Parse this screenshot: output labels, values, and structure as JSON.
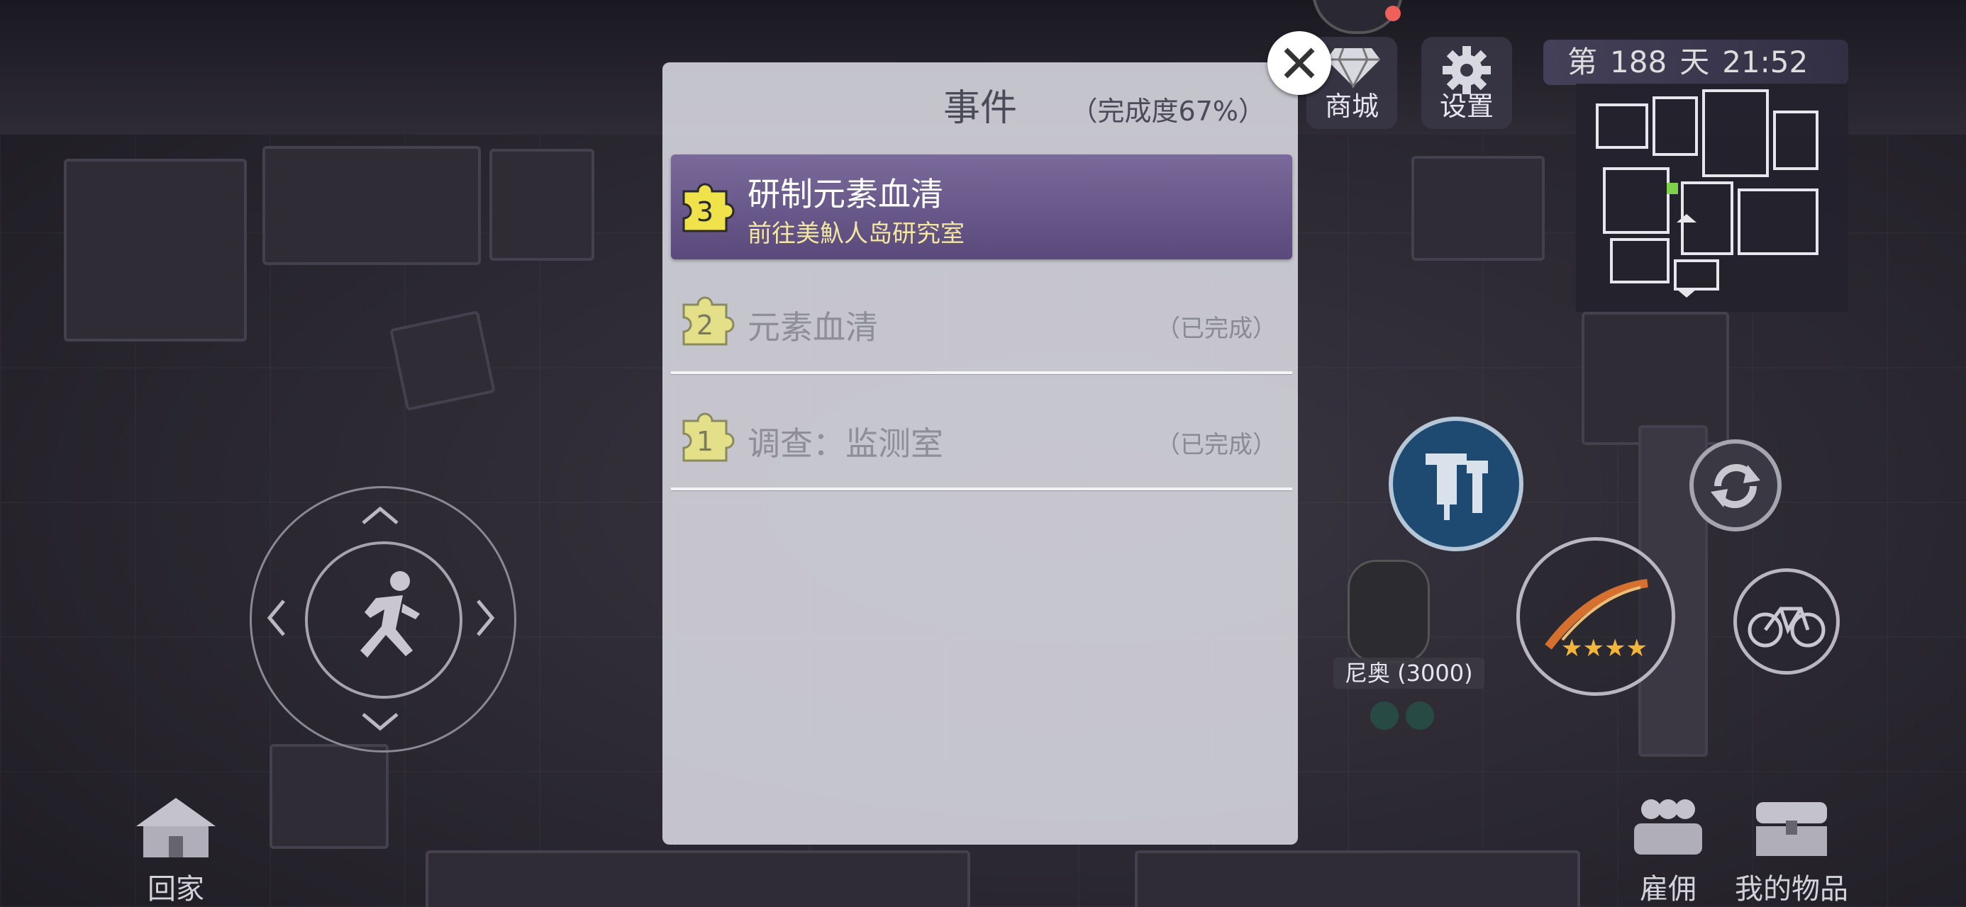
{
  "hud": {
    "shop_label": "商城",
    "settings_label": "设置",
    "day_prefix": "第",
    "day_number": "188",
    "day_suffix": "天",
    "time": "21:52"
  },
  "character": {
    "name_label": "尼奥 (3000)"
  },
  "weapon": {
    "stars": 4
  },
  "bottom": {
    "home_label": "回家",
    "hire_label": "雇佣",
    "items_label": "我的物品"
  },
  "dialog": {
    "title": "事件",
    "progress": "（完成度67%）",
    "events": [
      {
        "number": "3",
        "title": "研制元素血清",
        "subtitle": "前往美魞人岛研究室",
        "status": ""
      },
      {
        "number": "2",
        "title": "元素血清",
        "subtitle": "",
        "status": "（已完成）"
      },
      {
        "number": "1",
        "title": "调查：监测室",
        "subtitle": "",
        "status": "（已完成）"
      }
    ]
  },
  "colors": {
    "active_row": "#6a5a8c",
    "puzzle_active": "#f0e24a",
    "puzzle_done": "#e4e08a",
    "subtitle": "#f3e6a0"
  }
}
